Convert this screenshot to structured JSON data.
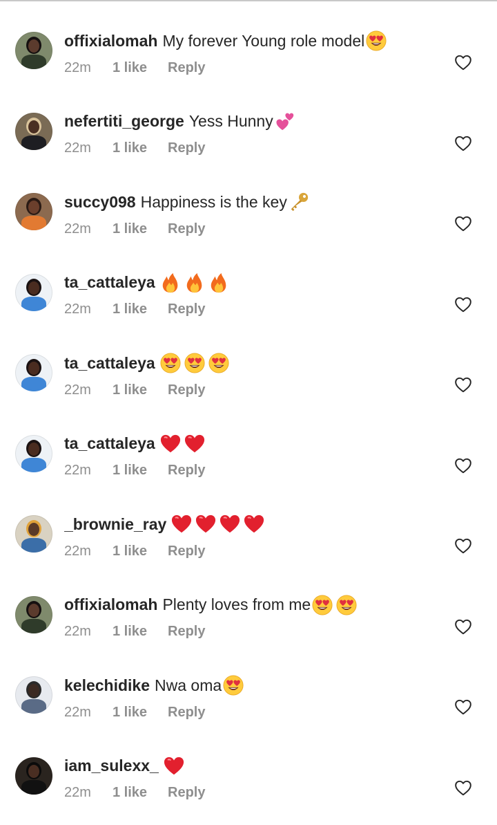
{
  "colors": {
    "text": "#262626",
    "secondary": "#8e8e8e",
    "background": "#ffffff"
  },
  "comments": [
    {
      "username": "offixialomah",
      "text": "My forever Young role model",
      "emojis": [
        "heart-eyes-emoji"
      ],
      "time": "22m",
      "likes": "1 like",
      "reply": "Reply",
      "avatar": {
        "bg": "#7f8a6c",
        "skin": "#5b3b2d",
        "shirt": "#2f3b2a",
        "hair": "#151010"
      }
    },
    {
      "username": "nefertiti_george",
      "text": "Yess Hunny",
      "emojis": [
        "two-hearts-emoji"
      ],
      "time": "22m",
      "likes": "1 like",
      "reply": "Reply",
      "avatar": {
        "bg": "#7a6b55",
        "skin": "#4a2f22",
        "shirt": "#1e1e22",
        "hair": "#d9c39b"
      }
    },
    {
      "username": "succy098",
      "text": "Happiness is the key",
      "emojis": [
        "key-emoji"
      ],
      "time": "22m",
      "likes": "1 like",
      "reply": "Reply",
      "avatar": {
        "bg": "#8c6a4f",
        "skin": "#6b3f2c",
        "shirt": "#e27a32",
        "hair": "#2a1a14"
      }
    },
    {
      "username": "ta_cattaleya",
      "text": "",
      "emojis": [
        "fire-emoji",
        "fire-emoji",
        "fire-emoji"
      ],
      "time": "22m",
      "likes": "1 like",
      "reply": "Reply",
      "avatar": {
        "bg": "#eef2f6",
        "skin": "#4a2c20",
        "shirt": "#3f86d6",
        "hair": "#1a1212"
      }
    },
    {
      "username": "ta_cattaleya",
      "text": "",
      "emojis": [
        "heart-eyes-emoji",
        "heart-eyes-emoji",
        "heart-eyes-emoji"
      ],
      "time": "22m",
      "likes": "1 like",
      "reply": "Reply",
      "avatar": {
        "bg": "#eef2f6",
        "skin": "#4a2c20",
        "shirt": "#3f86d6",
        "hair": "#1a1212"
      }
    },
    {
      "username": "ta_cattaleya",
      "text": "",
      "emojis": [
        "red-heart-emoji",
        "red-heart-emoji"
      ],
      "time": "22m",
      "likes": "1 like",
      "reply": "Reply",
      "avatar": {
        "bg": "#eef2f6",
        "skin": "#4a2c20",
        "shirt": "#3f86d6",
        "hair": "#1a1212"
      }
    },
    {
      "username": "_brownie_ray",
      "text": "",
      "emojis": [
        "red-heart-emoji",
        "red-heart-emoji",
        "red-heart-emoji",
        "red-heart-emoji"
      ],
      "time": "22m",
      "likes": "1 like",
      "reply": "Reply",
      "avatar": {
        "bg": "#d9d2c2",
        "skin": "#5a3a28",
        "shirt": "#3b6ea8",
        "hair": "#e0a23a"
      }
    },
    {
      "username": "offixialomah",
      "text": "Plenty loves from me",
      "emojis": [
        "heart-eyes-emoji",
        "heart-eyes-emoji"
      ],
      "time": "22m",
      "likes": "1 like",
      "reply": "Reply",
      "avatar": {
        "bg": "#7f8a6c",
        "skin": "#5b3b2d",
        "shirt": "#2f3b2a",
        "hair": "#151010"
      }
    },
    {
      "username": "kelechidike",
      "text": "Nwa oma",
      "emojis": [
        "heart-eyes-emoji"
      ],
      "time": "22m",
      "likes": "1 like",
      "reply": "Reply",
      "avatar": {
        "bg": "#e7eaef",
        "skin": "#3c2a22",
        "shirt": "#5a6b86",
        "hair": "#2a2a2a"
      }
    },
    {
      "username": "iam_sulexx_",
      "text": "",
      "emojis": [
        "red-heart-emoji"
      ],
      "time": "22m",
      "likes": "1 like",
      "reply": "Reply",
      "avatar": {
        "bg": "#2a241f",
        "skin": "#4a2e22",
        "shirt": "#111111",
        "hair": "#0b0b0b"
      }
    }
  ]
}
